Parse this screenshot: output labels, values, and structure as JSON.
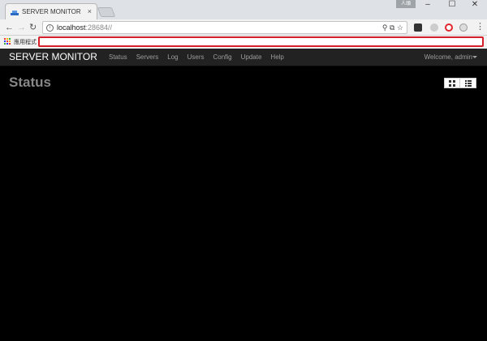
{
  "browser": {
    "tab_title": "SERVER MONITOR",
    "tab_close": "×",
    "user_badge": "人頭",
    "minimize": "–",
    "maximize": "☐",
    "close": "✕",
    "url_host": "localhost",
    "url_port": ":28684//",
    "bookmarks_label": "應用程式"
  },
  "navbar": {
    "brand": "SERVER MONITOR",
    "links": [
      "Status",
      "Servers",
      "Log",
      "Users",
      "Config",
      "Update",
      "Help"
    ],
    "welcome": "Welcome, admin"
  },
  "page": {
    "title": "Status"
  },
  "colors": {
    "accent_red": "#d4202a",
    "navbar_bg": "#222222",
    "page_bg": "#000000"
  }
}
